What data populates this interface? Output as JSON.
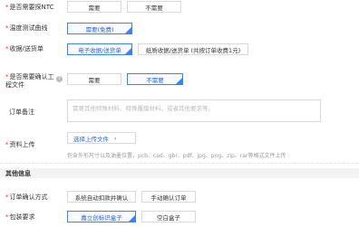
{
  "ntc": {
    "label": "是否需要探NTC",
    "options": [
      "需要",
      "不需要"
    ]
  },
  "temp_curve": {
    "label": "温度测试曲线",
    "options": [
      "需要(免费)"
    ]
  },
  "invoice": {
    "label": "收据/送货单",
    "options": [
      "电子收据/送货单",
      "纸质收据/送货单 (共按订单收费1元)"
    ]
  },
  "confirm_process": {
    "label": "是否需要确认工\n程文件",
    "options": [
      "需要",
      "不需要"
    ]
  },
  "order_note": {
    "label": "订单备注",
    "placeholder": "需要其他特殊材料、特殊覆膜材料，或者其他要求等。"
  },
  "upload": {
    "label": "资料上传",
    "button_label": "选择上传文件",
    "chevron": "›",
    "hint": "包含外形尺寸以及油墨位置，pcb、cad、gbr、pdf、jpg、png、zip、rar等格式文件上传"
  },
  "other_section": {
    "title": "其他信息"
  },
  "order_confirm": {
    "label": "订单确认方式",
    "options": [
      "系统自动扣款并确认",
      "手动确认订单"
    ]
  },
  "packaging": {
    "label": "包装要求",
    "options": [
      "嘉立创标识盒子",
      "空白盒子"
    ]
  },
  "icons": {
    "help": "?"
  },
  "colors": {
    "accent": "#3b82f6",
    "required": "#e53935"
  }
}
